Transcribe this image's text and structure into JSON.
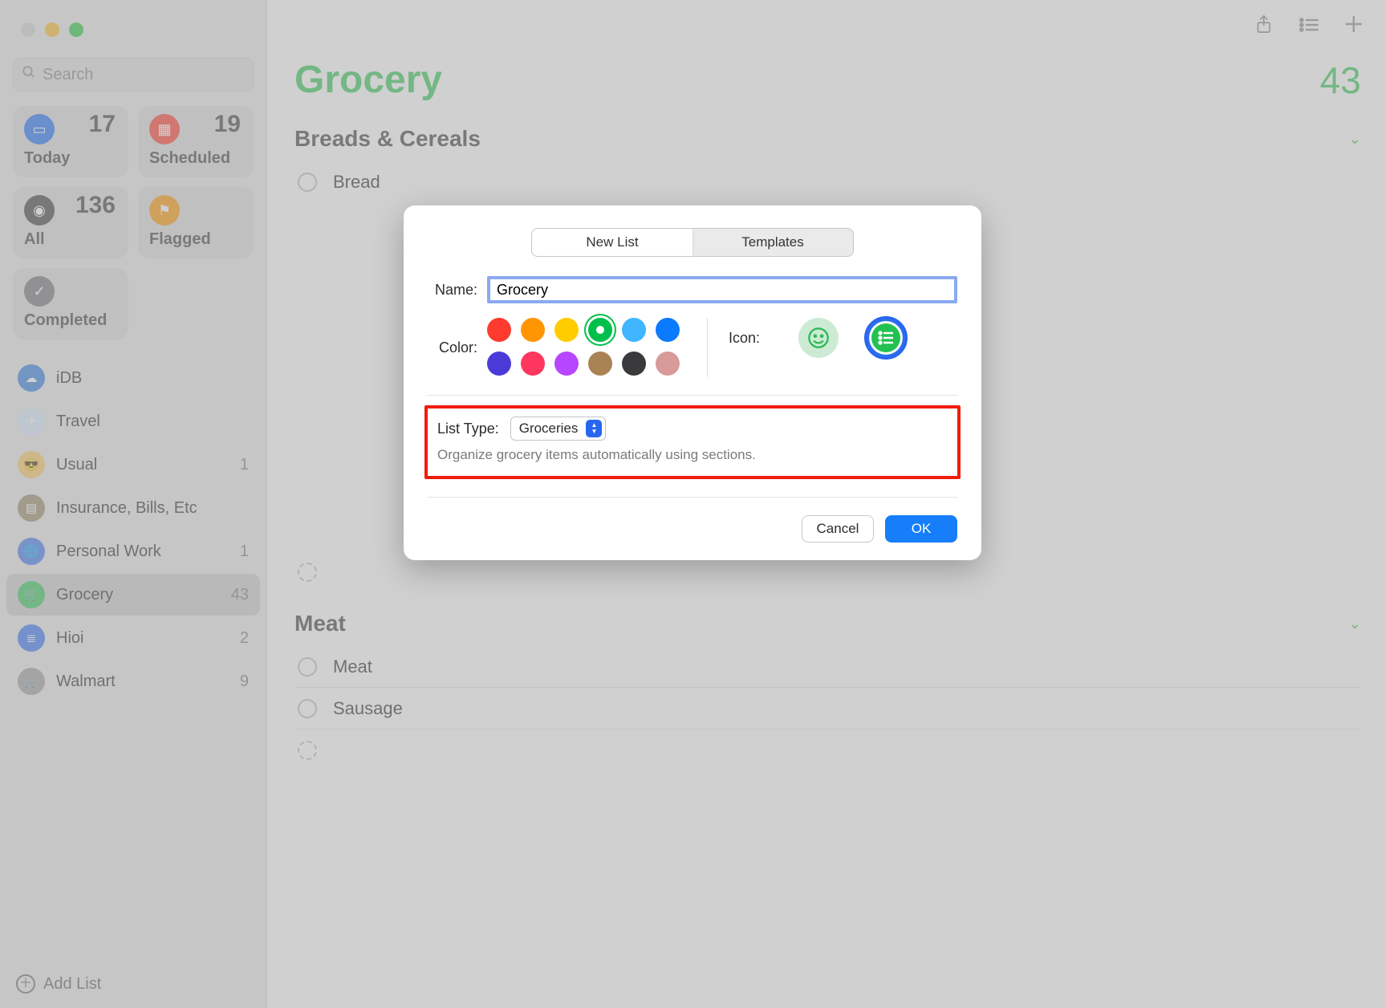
{
  "sidebar": {
    "search_placeholder": "Search",
    "boxes": {
      "today": {
        "label": "Today",
        "count": "17"
      },
      "scheduled": {
        "label": "Scheduled",
        "count": "19"
      },
      "all": {
        "label": "All",
        "count": "136"
      },
      "flagged": {
        "label": "Flagged",
        "count": ""
      },
      "completed": {
        "label": "Completed",
        "count": ""
      }
    },
    "lists": [
      {
        "id": "idb",
        "label": "iDB",
        "count": "",
        "icon": "☁"
      },
      {
        "id": "travel",
        "label": "Travel",
        "count": "",
        "icon": "✈"
      },
      {
        "id": "usual",
        "label": "Usual",
        "count": "1",
        "icon": "😎"
      },
      {
        "id": "insurance",
        "label": "Insurance, Bills, Etc",
        "count": "",
        "icon": "▤"
      },
      {
        "id": "personal",
        "label": "Personal Work",
        "count": "1",
        "icon": "🌐"
      },
      {
        "id": "grocery",
        "label": "Grocery",
        "count": "43",
        "icon": "🛒",
        "active": true
      },
      {
        "id": "hioi",
        "label": "Hioi",
        "count": "2",
        "icon": "≣"
      },
      {
        "id": "walmart",
        "label": "Walmart",
        "count": "9",
        "icon": "🛒"
      }
    ],
    "add_list_label": "Add List"
  },
  "main": {
    "title": "Grocery",
    "count": "43",
    "sections": [
      {
        "title": "Breads & Cereals",
        "items": [
          "Bread"
        ],
        "hidden_count": 1
      },
      {
        "title": "Meat",
        "items": [
          "Meat",
          "Sausage"
        ],
        "trailing_blank": true
      }
    ],
    "blank_item_token": ""
  },
  "dialog": {
    "segmented": {
      "new_list": "New List",
      "templates": "Templates"
    },
    "name_label": "Name:",
    "name_value": "Grocery",
    "color_label": "Color:",
    "colors_row1": [
      "#ff3b30",
      "#ff9500",
      "#ffcc00",
      "#00c04b",
      "#3fb6ff",
      "#0a7aff"
    ],
    "colors_row2": [
      "#4a3bd9",
      "#ff375f",
      "#b646ff",
      "#a98353",
      "#3a3a3c",
      "#d99a9a"
    ],
    "selected_color_index": 3,
    "icon_label": "Icon:",
    "list_type_label": "List Type:",
    "list_type_value": "Groceries",
    "list_type_desc": "Organize grocery items automatically using sections.",
    "cancel_label": "Cancel",
    "ok_label": "OK"
  }
}
